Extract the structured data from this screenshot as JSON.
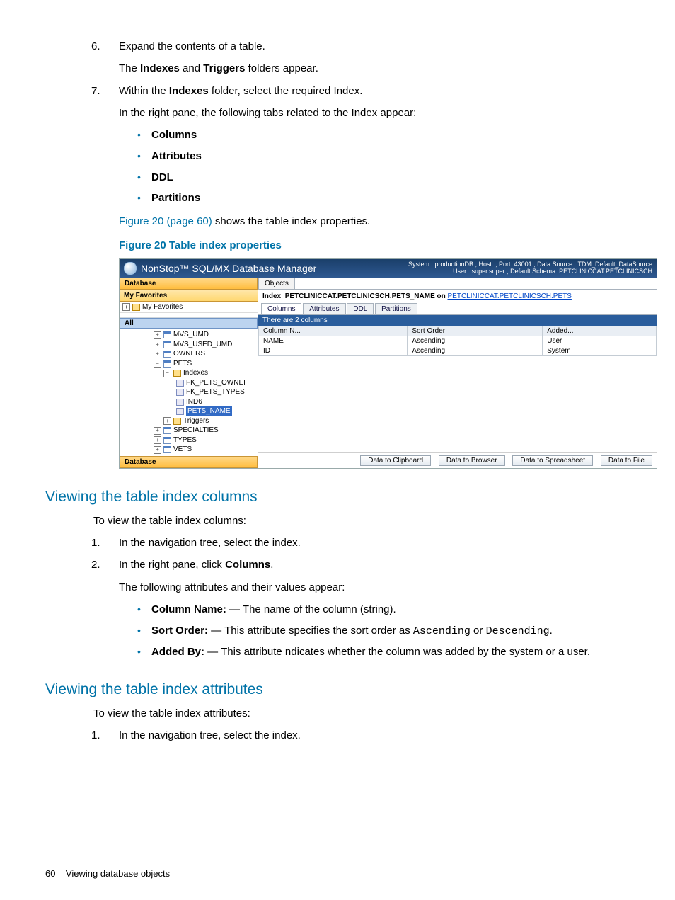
{
  "step6": {
    "num": "6.",
    "text_a": "Expand the contents of a table.",
    "text_b_a": "The ",
    "text_b_b": "Indexes",
    "text_b_c": " and ",
    "text_b_d": "Triggers",
    "text_b_e": " folders appear."
  },
  "step7": {
    "num": "7.",
    "text_a_a": "Within the ",
    "text_a_b": "Indexes",
    "text_a_c": " folder, select the required Index.",
    "text_b": "In the right pane, the following tabs related to the Index appear:"
  },
  "tabsList": {
    "i0": "Columns",
    "i1": "Attributes",
    "i2": "DDL",
    "i3": "Partitions"
  },
  "figref": {
    "a": "Figure 20 (page 60)",
    "b": " shows the table index properties."
  },
  "figcap": "Figure 20 Table index properties",
  "shot": {
    "appTitle": "NonStop™ SQL/MX Database Manager",
    "sysRight1": "System : productionDB , Host:                       , Port: 43001 , Data Source : TDM_Default_DataSource",
    "sysRight2": "User : super.super , Default Schema: PETCLINICCAT.PETCLINICSCH",
    "sectDatabase": "Database",
    "myFav": "My Favorites",
    "favItem": "My Favorites",
    "allTab": "All",
    "tree": {
      "t0": "MVS_UMD",
      "t1": "MVS_USED_UMD",
      "t2": "OWNERS",
      "t3": "PETS",
      "idx": "Indexes",
      "i0": "FK_PETS_OWNEI",
      "i1": "FK_PETS_TYPES",
      "i2": "IND6",
      "i3": "PETS_NAME",
      "trg": "Triggers",
      "t4": "SPECIALTIES",
      "t5": "TYPES",
      "t6": "VETS"
    },
    "sectDatabase2": "Database",
    "objects": "Objects",
    "idxTitle": {
      "a": "Index",
      "b": "PETCLINICCAT.PETCLINICSCH.PETS_NAME  on  ",
      "c": "PETCLINICCAT.PETCLINICSCH.PETS"
    },
    "tabs": {
      "t0": "Columns",
      "t1": "Attributes",
      "t2": "DDL",
      "t3": "Partitions"
    },
    "count": "There are 2 columns",
    "grid": {
      "h0": "Column N...",
      "h1": "Sort Order",
      "h2": "Added...",
      "r0c0": "NAME",
      "r0c1": "Ascending",
      "r0c2": "User",
      "r1c0": "ID",
      "r1c1": "Ascending",
      "r1c2": "System"
    },
    "btns": {
      "b0": "Data to Clipboard",
      "b1": "Data to Browser",
      "b2": "Data to Spreadsheet",
      "b3": "Data to File"
    }
  },
  "h2a": "Viewing the table index columns",
  "secA": {
    "intro": "To view the table index columns:",
    "s1": {
      "n": "1.",
      "t": "In the navigation tree, select the index."
    },
    "s2": {
      "n": "2.",
      "a": "In the right pane, click ",
      "b": "Columns",
      "c": "."
    },
    "s2b": "The following attributes and their values appear:",
    "li0": {
      "a": "Column Name:",
      "b": " — The name of the column (string)."
    },
    "li1": {
      "a": "Sort Order:",
      "b": " — This attribute specifies the sort order as ",
      "c": "Ascending",
      "d": " or ",
      "e": "Descending",
      "f": "."
    },
    "li2": {
      "a": "Added By:",
      "b": " — This attribute ndicates whether the column was added by the system or a user."
    }
  },
  "h2b": "Viewing the table index attributes",
  "secB": {
    "intro": "To view the table index attributes:",
    "s1": {
      "n": "1.",
      "t": "In the navigation tree, select the index."
    }
  },
  "footer": {
    "page": "60",
    "title": "Viewing database objects"
  }
}
